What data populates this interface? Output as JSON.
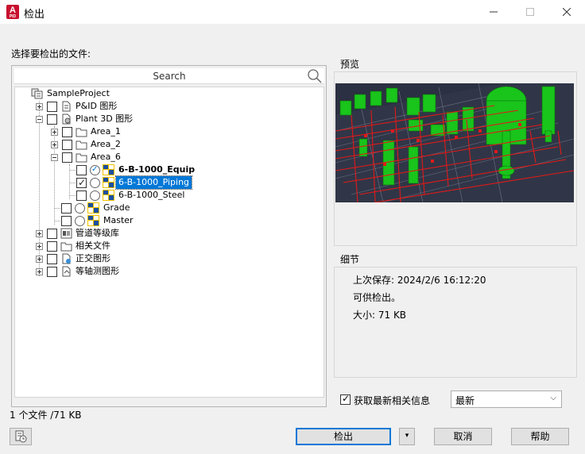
{
  "window": {
    "title": "检出",
    "app_icon_letter": "A",
    "app_icon_sub": "PID"
  },
  "prompt_label": "选择要检出的文件:",
  "search": {
    "label": "Search"
  },
  "tree": {
    "root": "SampleProject",
    "pid": "P&ID 图形",
    "plant3d": "Plant 3D 图形",
    "area1": "Area_1",
    "area2": "Area_2",
    "area6": "Area_6",
    "equip": "6-B-1000_Equip",
    "piping": "6-B-1000_Piping",
    "steel": "6-B-1000_Steel",
    "grade": "Grade",
    "master": "Master",
    "pipespec": "管道等级库",
    "related": "相关文件",
    "ortho": "正交图形",
    "iso": "等轴测图形"
  },
  "preview": {
    "title": "预览"
  },
  "details": {
    "title": "细节",
    "last_saved": "上次保存: 2024/2/6 16:12:20",
    "availability": "可供检出。",
    "size": "大小: 71 KB"
  },
  "file_count": "1 个文件 /71 KB",
  "get_latest": {
    "label": "获取最新相关信息",
    "checked": true
  },
  "version_combo": {
    "value": "最新"
  },
  "buttons": {
    "checkout": "检出",
    "cancel": "取消",
    "help": "帮助"
  },
  "colors": {
    "selection": "#0078d7",
    "preview_bg": "#2a2f40",
    "equipment_green": "#19c41b",
    "piping_red": "#e01a1a"
  }
}
